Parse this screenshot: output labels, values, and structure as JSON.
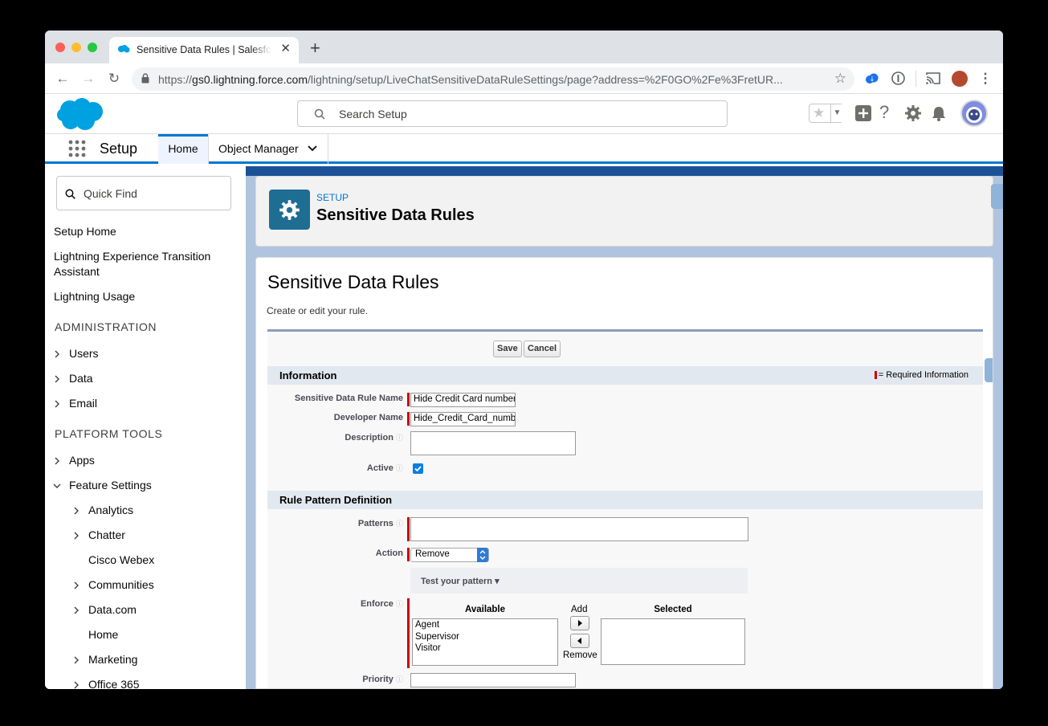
{
  "browser": {
    "tab_title": "Sensitive Data Rules | Salesforce",
    "new_tab": "+",
    "url_host": "gs0.lightning.force.com",
    "url_scheme": "https://",
    "url_path": "/lightning/setup/LiveChatSensitiveDataRuleSettings/page?address=%2F0GO%2Fe%3FretUR..."
  },
  "header": {
    "search_placeholder": "Search Setup"
  },
  "appnav": {
    "app_name": "Setup",
    "tabs": [
      {
        "label": "Home"
      },
      {
        "label": "Object Manager"
      }
    ]
  },
  "sidebar": {
    "quick_find_placeholder": "Quick Find",
    "items": [
      {
        "label": "Setup Home"
      },
      {
        "label": "Lightning Experience Transition Assistant"
      },
      {
        "label": "Lightning Usage"
      }
    ],
    "sections": [
      {
        "title": "ADMINISTRATION",
        "items": [
          "Users",
          "Data",
          "Email"
        ]
      },
      {
        "title": "PLATFORM TOOLS",
        "items": [
          "Apps",
          "Feature Settings"
        ]
      }
    ],
    "feature_settings_children": [
      "Analytics",
      "Chatter",
      "Cisco Webex",
      "Communities",
      "Data.com",
      "Home",
      "Marketing",
      "Office 365"
    ]
  },
  "page_header": {
    "eyebrow": "SETUP",
    "title": "Sensitive Data Rules"
  },
  "content": {
    "title": "Sensitive Data Rules",
    "description": "Create or edit your rule.",
    "save_label": "Save",
    "cancel_label": "Cancel",
    "required_info": "= Required Information",
    "sections": {
      "information": "Information",
      "rule_pattern": "Rule Pattern Definition"
    },
    "fields": {
      "rule_name_label": "Sensitive Data Rule Name",
      "rule_name_value": "Hide Credit Card number",
      "developer_name_label": "Developer Name",
      "developer_name_value": "Hide_Credit_Card_number",
      "description_label": "Description",
      "active_label": "Active",
      "active_checked": true,
      "patterns_label": "Patterns",
      "action_label": "Action",
      "action_value": "Remove",
      "test_pattern_label": "Test your pattern",
      "enforce_label": "Enforce",
      "available_label": "Available",
      "selected_label": "Selected",
      "add_label": "Add",
      "remove_label": "Remove",
      "available_options": [
        "Agent",
        "Supervisor",
        "Visitor"
      ],
      "priority_label": "Priority"
    }
  },
  "colors": {
    "brand": "#0176d3",
    "setup_tile": "#1e6e93",
    "required": "#c00"
  }
}
